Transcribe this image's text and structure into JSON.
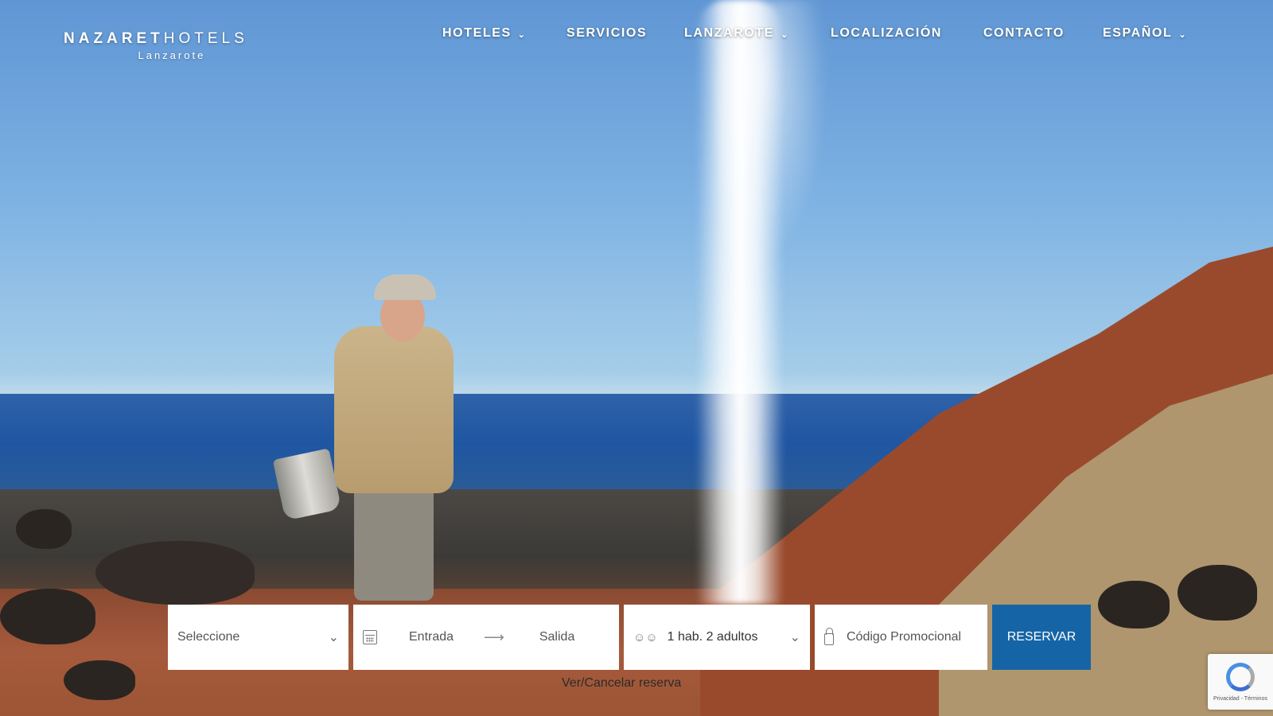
{
  "logo": {
    "brand_bold": "NAZARET",
    "brand_light": "HOTELS",
    "subtitle": "Lanzarote"
  },
  "nav": {
    "items": [
      {
        "label": "HOTELES",
        "has_dropdown": true
      },
      {
        "label": "SERVICIOS",
        "has_dropdown": false
      },
      {
        "label": "LANZAROTE",
        "has_dropdown": true
      },
      {
        "label": "LOCALIZACIÓN",
        "has_dropdown": false
      },
      {
        "label": "CONTACTO",
        "has_dropdown": false
      },
      {
        "label": "ESPAÑOL",
        "has_dropdown": true
      }
    ]
  },
  "booking": {
    "hotel_select": "Seleccione",
    "checkin_placeholder": "Entrada",
    "checkout_placeholder": "Salida",
    "guests": "1 hab. 2 adultos",
    "promo_placeholder": "Código Promocional",
    "reserve_label": "RESERVAR",
    "view_cancel_link": "Ver/Cancelar reserva",
    "reserve_color": "#1565a6"
  },
  "recaptcha": {
    "text": "Privacidad - Términos"
  }
}
